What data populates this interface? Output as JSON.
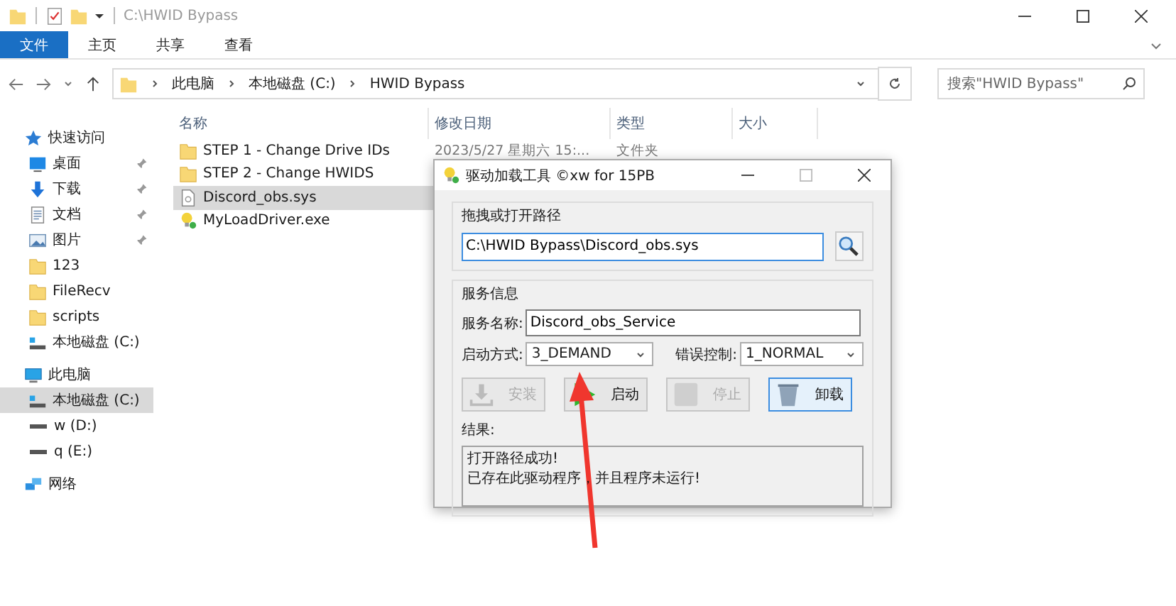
{
  "window": {
    "title": "C:\\HWID Bypass"
  },
  "ribbon_tabs": [
    {
      "label": "文件",
      "selected": true
    },
    {
      "label": "主页",
      "selected": false
    },
    {
      "label": "共享",
      "selected": false
    },
    {
      "label": "查看",
      "selected": false
    }
  ],
  "breadcrumb": [
    "此电脑",
    "本地磁盘 (C:)",
    "HWID Bypass"
  ],
  "search": {
    "placeholder": "搜索\"HWID Bypass\""
  },
  "sidebar": {
    "items": [
      {
        "label": "快速访问",
        "kind": "star",
        "selected": false,
        "children": [
          {
            "label": "桌面",
            "kind": "desktop",
            "pinned": true,
            "selected": false
          },
          {
            "label": "下载",
            "kind": "download",
            "pinned": true,
            "selected": false
          },
          {
            "label": "文档",
            "kind": "document",
            "pinned": true,
            "selected": false
          },
          {
            "label": "图片",
            "kind": "image",
            "pinned": true,
            "selected": false
          },
          {
            "label": "123",
            "kind": "folder",
            "pinned": false,
            "selected": false
          },
          {
            "label": "FileRecv",
            "kind": "folder",
            "pinned": false,
            "selected": false
          },
          {
            "label": "scripts",
            "kind": "folder",
            "pinned": false,
            "selected": false
          },
          {
            "label": "本地磁盘 (C:)",
            "kind": "drive",
            "pinned": false,
            "selected": false
          }
        ]
      },
      {
        "label": "此电脑",
        "kind": "pc",
        "selected": false,
        "children": [
          {
            "label": "本地磁盘 (C:)",
            "kind": "drive",
            "pinned": false,
            "selected": true
          },
          {
            "label": "w (D:)",
            "kind": "disk",
            "pinned": false,
            "selected": false
          },
          {
            "label": "q (E:)",
            "kind": "disk",
            "pinned": false,
            "selected": false
          }
        ]
      },
      {
        "label": "网络",
        "kind": "network",
        "selected": false
      }
    ]
  },
  "table": {
    "columns": [
      "名称",
      "修改日期",
      "类型",
      "大小"
    ],
    "rows": [
      {
        "name": "STEP 1 - Change Drive IDs",
        "kind": "folder",
        "selected": false,
        "date": "2023/5/27 星期六 15:...",
        "type": "文件夹"
      },
      {
        "name": "STEP 2 - Change HWIDS",
        "kind": "folder",
        "selected": false
      },
      {
        "name": "Discord_obs.sys",
        "kind": "sys",
        "selected": true
      },
      {
        "name": "MyLoadDriver.exe",
        "kind": "exe",
        "selected": false
      }
    ]
  },
  "dialog": {
    "title": "驱动加载工具 ©xw for 15PB",
    "path_group": {
      "title": "拖拽或打开路径",
      "path": "C:\\HWID Bypass\\Discord_obs.sys"
    },
    "service_group": {
      "title": "服务信息",
      "name_label": "服务名称:",
      "name": "Discord_obs_Service",
      "start_label": "启动方式:",
      "start": "3_DEMAND",
      "error_label": "错误控制:",
      "error": "1_NORMAL",
      "buttons": [
        {
          "label": "安装",
          "kind": "download",
          "disabled": true,
          "focused": false
        },
        {
          "label": "启动",
          "kind": "play",
          "disabled": false,
          "focused": false
        },
        {
          "label": "停止",
          "kind": "blank",
          "disabled": true,
          "focused": false
        },
        {
          "label": "卸载",
          "kind": "trash",
          "disabled": false,
          "focused": true
        }
      ],
      "result_label": "结果:",
      "result_lines": [
        "打开路径成功!",
        "已存在此驱动程序，并且程序未运行!"
      ]
    }
  }
}
